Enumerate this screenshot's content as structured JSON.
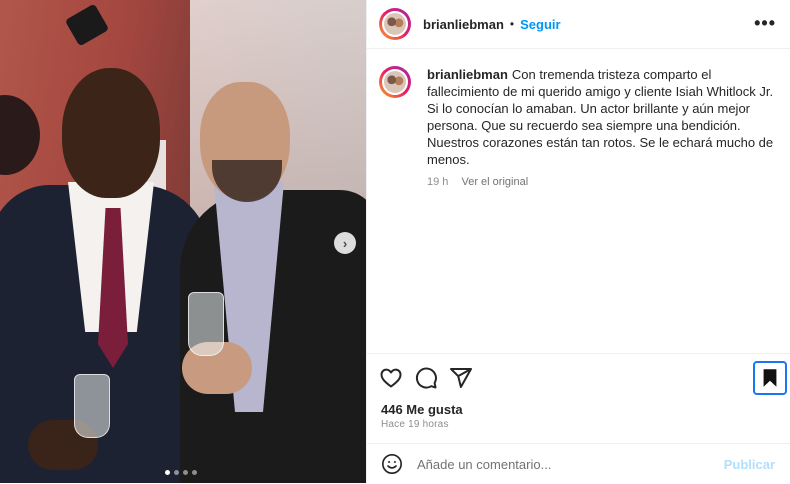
{
  "post": {
    "username": "brianliebman",
    "separator": "•",
    "follow_label": "Seguir",
    "more_label": "•••",
    "caption": {
      "username": "brianliebman",
      "text": "Con tremenda tristeza comparto el fallecimiento de mi querido amigo y cliente Isiah Whitlock Jr. Si lo conocían lo amaban. Un actor brillante y aún mejor persona. Que su recuerdo sea siempre una bendición. Nuestros corazones están tan rotos. Se le echará mucho de menos.",
      "age": "19 h",
      "see_original": "Ver el original"
    },
    "likes": "446 Me gusta",
    "posted": "Hace 19 horas",
    "comment_placeholder": "Añade un comentario...",
    "publish_label": "Publicar",
    "carousel": {
      "dots": 4,
      "active": 0
    },
    "colors": {
      "accent": "#0095f6",
      "publish_disabled": "#b2dffc",
      "focus_ring": "#1877f2"
    },
    "icons": [
      "heart-icon",
      "comment-icon",
      "share-icon",
      "bookmark-icon",
      "emoji-icon",
      "chevron-right-icon",
      "more-icon"
    ]
  }
}
